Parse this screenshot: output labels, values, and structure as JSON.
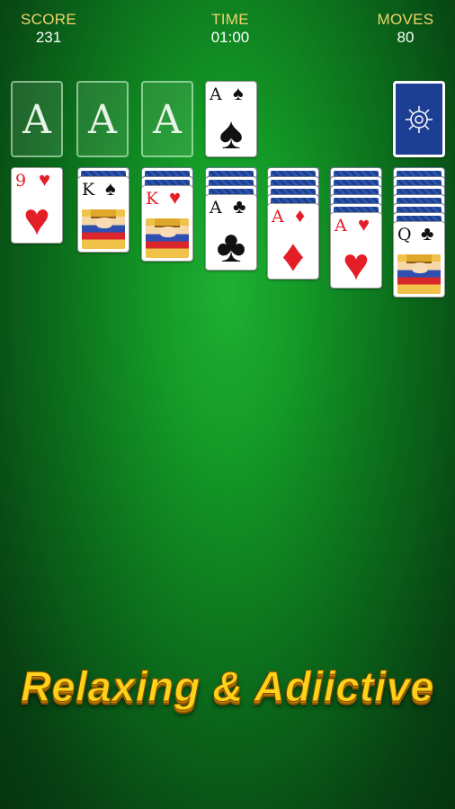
{
  "header": {
    "score_label": "SCORE",
    "score_value": "231",
    "time_label": "TIME",
    "time_value": "01:00",
    "moves_label": "MOVES",
    "moves_value": "80"
  },
  "foundations": [
    {
      "label": "A"
    },
    {
      "label": "A"
    },
    {
      "label": "A"
    },
    {
      "rank": "A",
      "suit": "♠",
      "color": "black"
    }
  ],
  "stock": {
    "icon": "compass-rose-icon"
  },
  "tableau": [
    {
      "hidden": 0,
      "card": {
        "rank": "9",
        "suit": "♥",
        "color": "red",
        "face": "pip"
      }
    },
    {
      "hidden": 1,
      "card": {
        "rank": "K",
        "suit": "♠",
        "color": "black",
        "face": "court"
      }
    },
    {
      "hidden": 2,
      "card": {
        "rank": "K",
        "suit": "♥",
        "color": "red",
        "face": "court"
      }
    },
    {
      "hidden": 3,
      "card": {
        "rank": "A",
        "suit": "♣",
        "color": "black",
        "face": "pip"
      }
    },
    {
      "hidden": 4,
      "card": {
        "rank": "A",
        "suit": "♦",
        "color": "red",
        "face": "pip"
      }
    },
    {
      "hidden": 5,
      "card": {
        "rank": "A",
        "suit": "♥",
        "color": "red",
        "face": "pip"
      }
    },
    {
      "hidden": 6,
      "card": {
        "rank": "Q",
        "suit": "♣",
        "color": "black",
        "face": "court"
      }
    }
  ],
  "slogan": "Relaxing & Adiictive",
  "colors": {
    "felt": "#149a27",
    "gold": "#ffd21a",
    "card_back": "#1f3f8c",
    "red_suit": "#e41e26"
  }
}
